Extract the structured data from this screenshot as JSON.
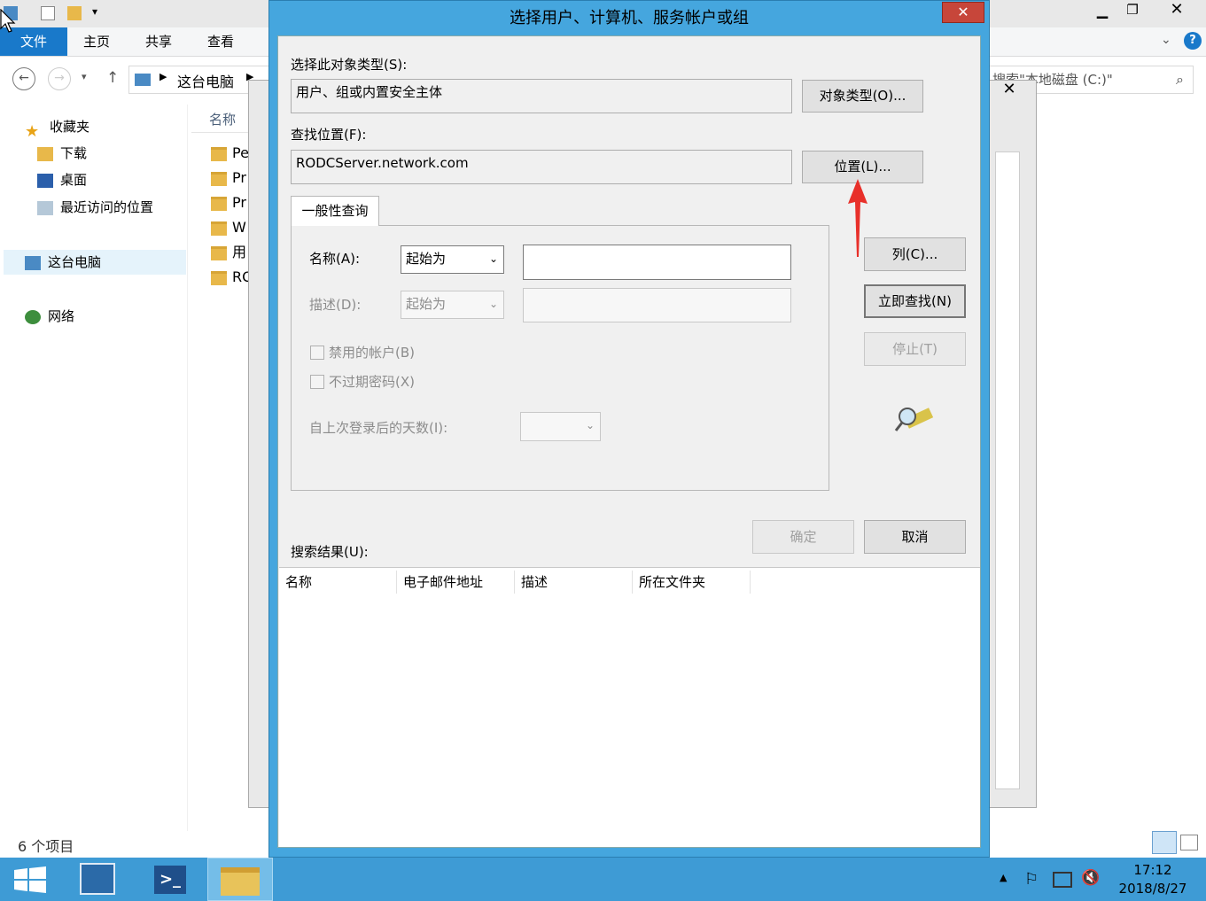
{
  "explorer": {
    "ribbon_tabs": [
      "文件",
      "主页",
      "共享",
      "查看"
    ],
    "address": "这台电脑",
    "search_text": "搜索\"本地磁盘 (C:)\"",
    "nav": {
      "favorites": "收藏夹",
      "downloads": "下载",
      "desktop": "桌面",
      "recent": "最近访问的位置",
      "this_pc": "这台电脑",
      "network": "网络"
    },
    "column_name": "名称",
    "files": [
      "Pe",
      "Pr",
      "Pr",
      "W",
      "用",
      "RO"
    ],
    "status": "6 个项目"
  },
  "dialog": {
    "title": "选择用户、计算机、服务帐户或组",
    "close": "✕",
    "object_type_label": "选择此对象类型(S):",
    "object_type_value": "用户、组或内置安全主体",
    "object_type_button": "对象类型(O)...",
    "location_label": "查找位置(F):",
    "location_value": "RODCServer.network.com",
    "location_button": "位置(L)...",
    "tab_general": "一般性查询",
    "name_label": "名称(A):",
    "name_op": "起始为",
    "desc_label": "描述(D):",
    "desc_op": "起始为",
    "disabled_accounts": "禁用的帐户(B)",
    "non_expiring": "不过期密码(X)",
    "days_label": "自上次登录后的天数(I):",
    "columns_button": "列(C)...",
    "find_now_button": "立即查找(N)",
    "stop_button": "停止(T)",
    "ok_button": "确定",
    "cancel_button": "取消",
    "results_label": "搜索结果(U):",
    "result_columns": [
      "名称",
      "电子邮件地址",
      "描述",
      "所在文件夹"
    ]
  },
  "taskbar": {
    "time": "17:12",
    "date": "2018/8/27"
  },
  "colors": {
    "dialog_frame": "#45a6de",
    "close_button": "#c7463a",
    "taskbar": "#3e9bd5",
    "file_tab": "#1979ca",
    "annotation_arrow": "#e8302a"
  }
}
